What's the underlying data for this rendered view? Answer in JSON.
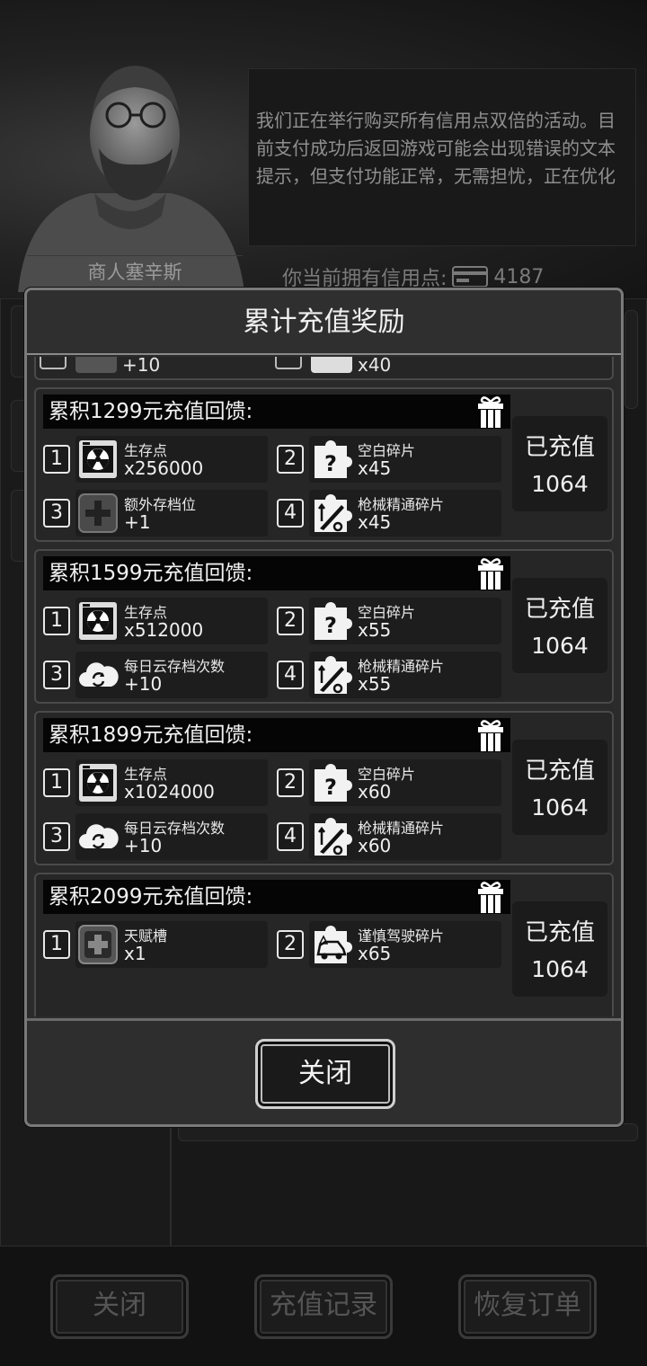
{
  "merchant": {
    "name": "商人塞辛斯",
    "message": "我们正在举行购买所有信用点双倍的活动。目前支付成功后返回游戏可能会出现错误的文本提示，但支付功能正常，无需担忧，正在优化"
  },
  "credits": {
    "label": "你当前拥有信用点:",
    "value": "4187"
  },
  "modal": {
    "title": "累计充值奖励",
    "partial_top": {
      "left_qty": "+10",
      "right_qty": "x40"
    },
    "tiers": [
      {
        "header": "累积1299元充值回馈:",
        "paid_label": "已充值",
        "paid_value": "1064",
        "items": [
          {
            "num": "1",
            "icon": "radiation-icon",
            "name": "生存点",
            "qty": "x256000"
          },
          {
            "num": "2",
            "icon": "puzzle-question-icon",
            "name": "空白碎片",
            "qty": "x45"
          },
          {
            "num": "3",
            "icon": "plus-slot-icon",
            "name": "额外存档位",
            "qty": "+1"
          },
          {
            "num": "4",
            "icon": "puzzle-rifle-icon",
            "name": "枪械精通碎片",
            "qty": "x45"
          }
        ]
      },
      {
        "header": "累积1599元充值回馈:",
        "paid_label": "已充值",
        "paid_value": "1064",
        "items": [
          {
            "num": "1",
            "icon": "radiation-icon",
            "name": "生存点",
            "qty": "x512000"
          },
          {
            "num": "2",
            "icon": "puzzle-question-icon",
            "name": "空白碎片",
            "qty": "x55"
          },
          {
            "num": "3",
            "icon": "cloud-sync-icon",
            "name": "每日云存档次数",
            "qty": "+10"
          },
          {
            "num": "4",
            "icon": "puzzle-rifle-icon",
            "name": "枪械精通碎片",
            "qty": "x55"
          }
        ]
      },
      {
        "header": "累积1899元充值回馈:",
        "paid_label": "已充值",
        "paid_value": "1064",
        "items": [
          {
            "num": "1",
            "icon": "radiation-icon",
            "name": "生存点",
            "qty": "x1024000"
          },
          {
            "num": "2",
            "icon": "puzzle-question-icon",
            "name": "空白碎片",
            "qty": "x60"
          },
          {
            "num": "3",
            "icon": "cloud-sync-icon",
            "name": "每日云存档次数",
            "qty": "+10"
          },
          {
            "num": "4",
            "icon": "puzzle-rifle-icon",
            "name": "枪械精通碎片",
            "qty": "x60"
          }
        ]
      },
      {
        "header": "累积2099元充值回馈:",
        "paid_label": "已充值",
        "paid_value": "1064",
        "items": [
          {
            "num": "1",
            "icon": "talent-slot-icon",
            "name": "天赋槽",
            "qty": "x1"
          },
          {
            "num": "2",
            "icon": "puzzle-car-icon",
            "name": "谨慎驾驶碎片",
            "qty": "x65"
          }
        ]
      }
    ],
    "close_label": "关闭"
  },
  "bottom": {
    "close_label": "关闭",
    "history_label": "充值记录",
    "restore_label": "恢复订单"
  }
}
